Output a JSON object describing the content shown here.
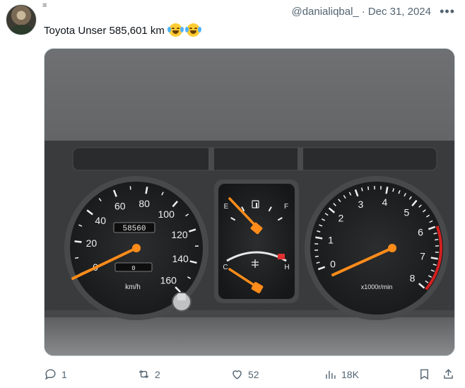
{
  "author": {
    "display_name": "=",
    "handle": "@danialiqbal_",
    "date": "Dec 31, 2024"
  },
  "tweet": {
    "text": "Toyota Unser 585,601 km",
    "emojis": [
      "face-with-tears-of-joy",
      "face-with-tears-of-joy"
    ]
  },
  "media": {
    "speedometer": {
      "ticks": [
        "0",
        "20",
        "40",
        "60",
        "80",
        "100",
        "120",
        "140",
        "160"
      ],
      "unit": "km/h",
      "odometer": "58560",
      "trip": "0"
    },
    "fuel_gauge": {
      "empty": "E",
      "full": "F"
    },
    "temp_gauge": {
      "cold": "C",
      "hot": "H"
    },
    "tachometer": {
      "ticks": [
        "0",
        "1",
        "2",
        "3",
        "4",
        "5",
        "6",
        "7",
        "8"
      ],
      "unit": "x1000r/min"
    }
  },
  "actions": {
    "replies": "1",
    "reposts": "2",
    "likes": "52",
    "views": "18K"
  },
  "colors": {
    "needle": "#ff8c1a",
    "redline": "#d42020",
    "meta_text": "#536471"
  }
}
